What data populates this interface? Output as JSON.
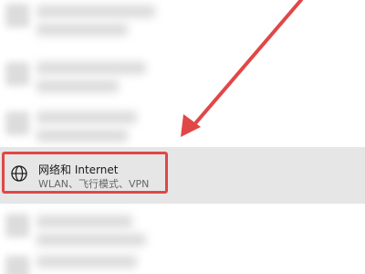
{
  "settings": {
    "network_item": {
      "title": "网络和 Internet",
      "subtitle": "WLAN、飞行模式、VPN",
      "icon": "globe-icon"
    }
  },
  "colors": {
    "highlight_border": "#e04747",
    "arrow": "#e04747",
    "selected_row_bg": "#e6e6e6"
  }
}
